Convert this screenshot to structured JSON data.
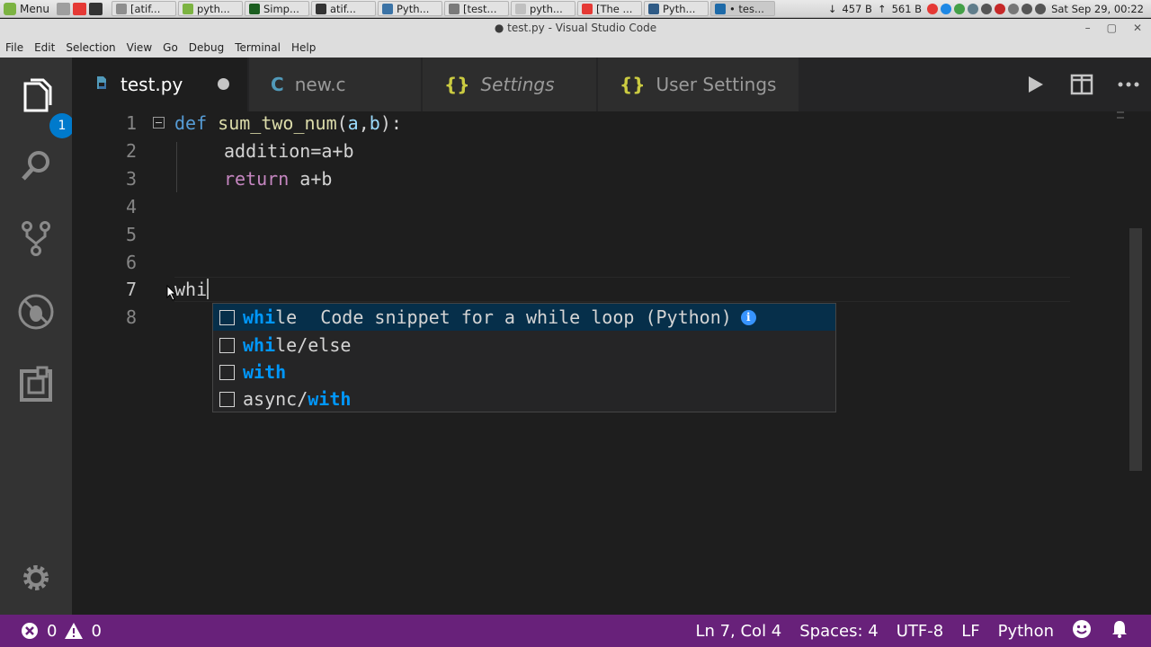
{
  "os": {
    "menu_label": "Menu",
    "tasks": [
      {
        "label": "[atif...",
        "color": "#8e8e8e"
      },
      {
        "label": "pyth...",
        "color": "#7cb342"
      },
      {
        "label": "Simp...",
        "color": "#1b5e20"
      },
      {
        "label": "atif...",
        "color": "#333333"
      },
      {
        "label": "Pyth...",
        "color": "#3b73a6"
      },
      {
        "label": "[test...",
        "color": "#7a7a7a"
      },
      {
        "label": "pyth...",
        "color": "#c0c0c0"
      },
      {
        "label": "[The ...",
        "color": "#e53935"
      },
      {
        "label": "Pyth...",
        "color": "#2f5b86"
      },
      {
        "label": "• tes...",
        "color": "#1e6aa8"
      }
    ],
    "net_down": "457 B",
    "net_up": "561 B",
    "clock": "Sat Sep 29, 00:22"
  },
  "window": {
    "title": "● test.py - Visual Studio Code",
    "controls": {
      "minimize": "–",
      "maximize": "▢",
      "close": "✕"
    }
  },
  "menu": {
    "file": "File",
    "edit": "Edit",
    "selection": "Selection",
    "view": "View",
    "go": "Go",
    "debug": "Debug",
    "terminal": "Terminal",
    "help": "Help"
  },
  "activity": {
    "explorer_badge": "1"
  },
  "tabs": [
    {
      "label": "test.py",
      "icon": "python-icon",
      "icon_color": "#519aba",
      "active": true,
      "dirty": true
    },
    {
      "label": "new.c",
      "icon_text": "C",
      "icon_color": "#519aba",
      "active": false
    },
    {
      "label": "Settings",
      "icon_text": "{}",
      "icon_color": "#cbcb41",
      "italic": true,
      "active": false
    },
    {
      "label": "User Settings",
      "icon_text": "{}",
      "icon_color": "#cbcb41",
      "active": false
    }
  ],
  "editor": {
    "line_numbers": [
      "1",
      "2",
      "3",
      "4",
      "5",
      "6",
      "7",
      "8"
    ],
    "line1": {
      "def": "def",
      "space": " ",
      "fn": "sum_two_num",
      "open": "(",
      "p1": "a",
      "comma": ",",
      "p2": "b",
      "close": "):"
    },
    "line2": "addition=a+b",
    "line3": {
      "ret": "return",
      "rest": " a+b"
    },
    "line7": "whi"
  },
  "suggest": {
    "items": [
      {
        "match": "whi",
        "rest": "le",
        "detail": "Code snippet for a while loop (Python)",
        "info": "i"
      },
      {
        "match": "whi",
        "rest": "le/else"
      },
      {
        "pre": "",
        "m1": "w",
        "mid": "",
        "m2": "i",
        "rest": "th",
        "text": "with"
      },
      {
        "pre": "async/",
        "m1": "w",
        "mid": "",
        "m2": "i",
        "rest": "th"
      }
    ]
  },
  "status": {
    "errors": "0",
    "warnings": "0",
    "position": "Ln 7, Col 4",
    "spaces": "Spaces: 4",
    "encoding": "UTF-8",
    "eol": "LF",
    "language": "Python"
  },
  "colors": {
    "statusbar": "#68217a",
    "accent": "#007acc",
    "keyword": "#569cd6",
    "control": "#c586c0",
    "function": "#dcdcaa",
    "match_highlight": "#0097fb"
  }
}
